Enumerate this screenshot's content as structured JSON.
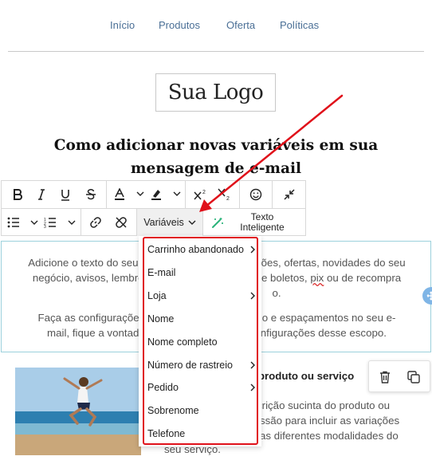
{
  "nav": {
    "items": [
      "Início",
      "Produtos",
      "Oferta",
      "Políticas"
    ]
  },
  "logo": {
    "text": "Sua Logo"
  },
  "heading": {
    "line1": "Como adicionar novas variáveis em sua",
    "line2": "mensagem de e-mail"
  },
  "toolbar": {
    "row1_icons": [
      "bold-icon",
      "italic-icon",
      "underline-icon",
      "strikethrough-icon",
      "text-color-icon",
      "highlight-color-icon",
      "superscript-icon",
      "subscript-icon",
      "emoji-icon",
      "collapse-icon"
    ],
    "row2_icons": [
      "bullet-list-icon",
      "numbered-list-icon",
      "link-icon",
      "unlink-icon",
      "magic-wand-icon"
    ],
    "variables_label": "Variáveis",
    "smart_text_line1": "Texto",
    "smart_text_line2": "Inteligente"
  },
  "body": {
    "p1_line1_a": "Adicione o texto do seu",
    "p1_line1_b": "ções, ofertas, novidades do seu",
    "p1_line2_a": "negócio, avisos, lembre",
    "p1_line2_b": "e boletos,",
    "p1_line2_pix": "pix",
    "p1_line2_c": "ou de recompra",
    "p1_line3": "o.",
    "p2_line1_a": "Faça as configurações",
    "p2_line1_b": "o e espaçamentos no seu e-",
    "p2_line2_a": "mail, fique a vontad",
    "p2_line2_b": "nfigurações desse escopo."
  },
  "product": {
    "title": "o produto ou serviço",
    "desc_line1": "crição sucinta do produto ou",
    "desc_line2": "issão para incluir as variações",
    "desc_line3": "as diferentes modalidades do",
    "desc_line4": "seu serviço."
  },
  "dropdown": {
    "items": [
      {
        "label": "Carrinho abandonado",
        "submenu": true
      },
      {
        "label": "E-mail",
        "submenu": false
      },
      {
        "label": "Loja",
        "submenu": true
      },
      {
        "label": "Nome",
        "submenu": false
      },
      {
        "label": "Nome completo",
        "submenu": false
      },
      {
        "label": "Número de rastreio",
        "submenu": true
      },
      {
        "label": "Pedido",
        "submenu": true
      },
      {
        "label": "Sobrenome",
        "submenu": false
      },
      {
        "label": "Telefone",
        "submenu": false
      }
    ]
  },
  "colors": {
    "nav_link": "#4a6f96",
    "annotation_red": "#e0111a",
    "selection_border": "#9cd1dc",
    "handle_blue": "#7fb5e6"
  }
}
